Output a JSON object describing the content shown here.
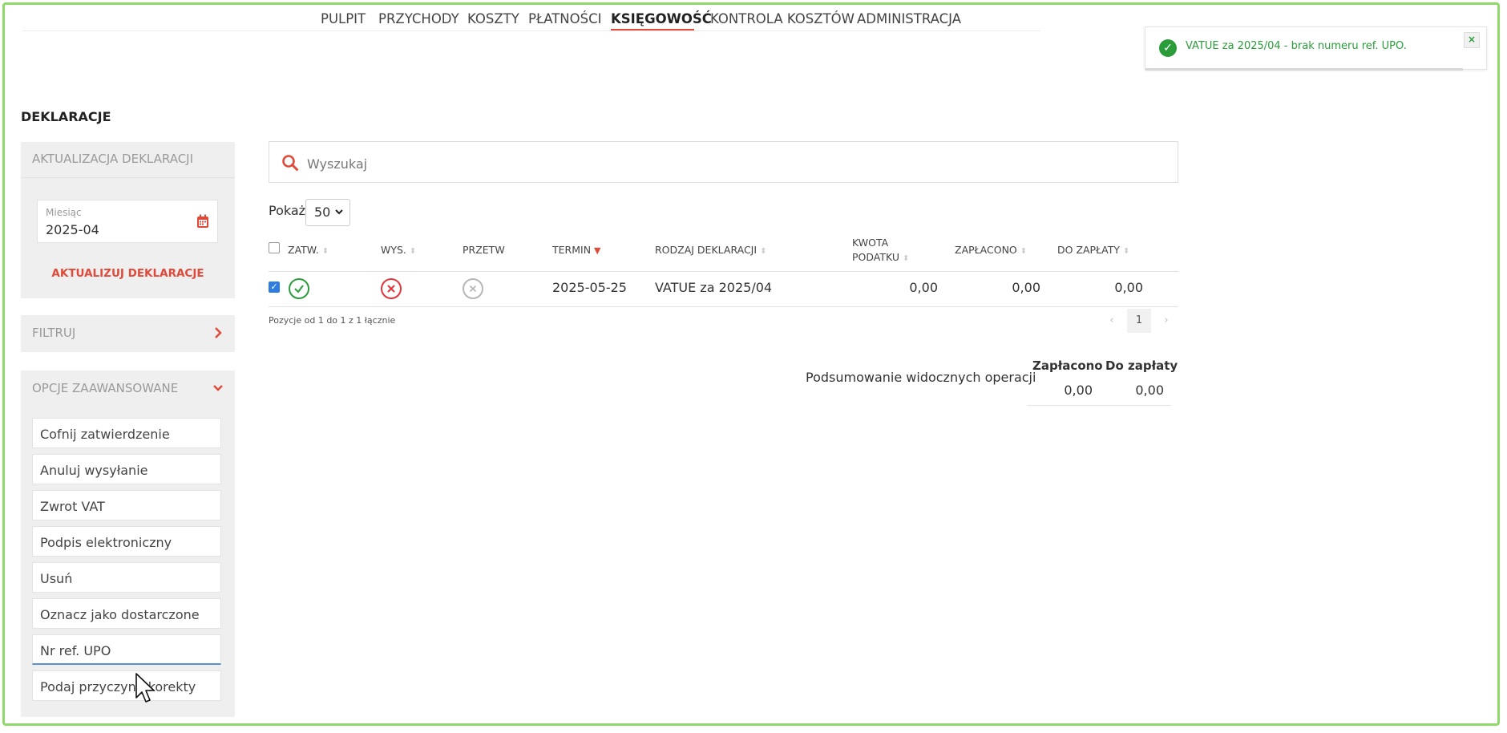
{
  "nav": {
    "items": [
      {
        "label": "PULPIT"
      },
      {
        "label": "PRZYCHODY"
      },
      {
        "label": "KOSZTY"
      },
      {
        "label": "PŁATNOŚCI"
      },
      {
        "label": "KSIĘGOWOŚĆ",
        "active": true
      },
      {
        "label": "KONTROLA KOSZTÓW"
      },
      {
        "label": "ADMINISTRACJA"
      }
    ]
  },
  "toast": {
    "message": "VATUE za 2025/04 - brak numeru ref. UPO.",
    "close": "×",
    "status_color": "#2a9d3a"
  },
  "page_title": "DEKLARACJE",
  "update_panel": {
    "title": "AKTUALIZACJA DEKLARACJI",
    "month_label": "Miesiąc",
    "month_value": "2025-04",
    "button": "AKTUALIZUJ DEKLARACJE"
  },
  "filter_panel": {
    "title": "FILTRUJ"
  },
  "advanced_panel": {
    "title": "OPCJE ZAAWANSOWANE",
    "options": [
      "Cofnij zatwierdzenie",
      "Anuluj wysyłanie",
      "Zwrot VAT",
      "Podpis elektroniczny",
      "Usuń",
      "Oznacz jako dostarczone",
      "Nr ref. UPO",
      "Podaj przyczynę korekty"
    ]
  },
  "search": {
    "placeholder": "Wyszukaj"
  },
  "show": {
    "label": "Pokaż",
    "value": "50"
  },
  "table": {
    "headers": {
      "zatw": "ZATW.",
      "wys": "WYS.",
      "przetw": "PRZETW",
      "termin": "TERMIN",
      "rodzaj": "RODZAJ DEKLARACJI",
      "kwota_1": "KWOTA",
      "kwota_2": "PODATKU",
      "zaplacono": "ZAPŁACONO",
      "do_zaplaty": "DO ZAPŁATY"
    },
    "rows": [
      {
        "selected": true,
        "zatw": "approved",
        "wys": "error",
        "przetw": "not-processed",
        "termin": "2025-05-25",
        "rodzaj": "VATUE za 2025/04",
        "kwota": "0,00",
        "zaplacono": "0,00",
        "do_zaplaty": "0,00"
      }
    ],
    "info": "Pozycje od 1 do 1 z 1 łącznie"
  },
  "pagination": {
    "prev": "‹",
    "current": "1",
    "next": "›"
  },
  "summary": {
    "label": "Podsumowanie widocznych operacji",
    "paid_header": "Zapłacono",
    "due_header": "Do zapłaty",
    "paid_value": "0,00",
    "due_value": "0,00"
  },
  "colors": {
    "accent": "#e04a3a",
    "success": "#2a9d3a",
    "error": "#e0353a",
    "frame": "#8fd86a"
  }
}
